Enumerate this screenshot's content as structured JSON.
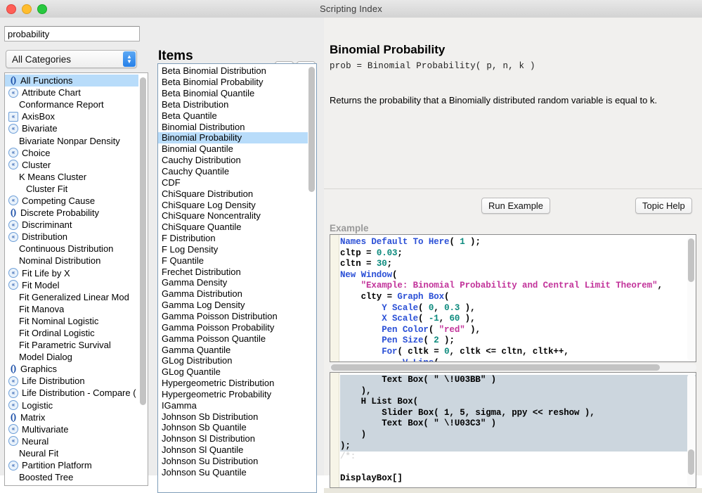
{
  "window": {
    "title": "Scripting Index"
  },
  "traffic_lights": {
    "close": "close-button",
    "minimize": "minimize-button",
    "maximize": "maximize-button"
  },
  "search": {
    "value": "probability",
    "placeholder": "",
    "search_icon": "magnifier-icon",
    "clear_icon": "x-icon",
    "settings_icon": "gear-icon"
  },
  "category": {
    "selected": "All Categories",
    "options": [
      "All Categories"
    ]
  },
  "tree": {
    "items": [
      {
        "label": "All Functions",
        "icon": "paren",
        "indent": 0,
        "selected": true
      },
      {
        "label": "Attribute Chart",
        "icon": "circ",
        "indent": 0,
        "selected": false
      },
      {
        "label": "Conformance Report",
        "icon": "blank",
        "indent": 1,
        "selected": false
      },
      {
        "label": "AxisBox",
        "icon": "sq",
        "indent": 0,
        "selected": false
      },
      {
        "label": "Bivariate",
        "icon": "circ",
        "indent": 0,
        "selected": false
      },
      {
        "label": "Bivariate Nonpar Density",
        "icon": "blank",
        "indent": 1,
        "selected": false
      },
      {
        "label": "Choice",
        "icon": "circ",
        "indent": 0,
        "selected": false
      },
      {
        "label": "Cluster",
        "icon": "circ",
        "indent": 0,
        "selected": false
      },
      {
        "label": "K Means Cluster",
        "icon": "blank",
        "indent": 1,
        "selected": false
      },
      {
        "label": "Cluster Fit",
        "icon": "blank",
        "indent": 2,
        "selected": false
      },
      {
        "label": "Competing Cause",
        "icon": "circ",
        "indent": 0,
        "selected": false
      },
      {
        "label": "Discrete Probability",
        "icon": "paren",
        "indent": 0,
        "selected": false
      },
      {
        "label": "Discriminant",
        "icon": "circ",
        "indent": 0,
        "selected": false
      },
      {
        "label": "Distribution",
        "icon": "circ",
        "indent": 0,
        "selected": false
      },
      {
        "label": "Continuous Distribution",
        "icon": "blank",
        "indent": 1,
        "selected": false
      },
      {
        "label": "Nominal Distribution",
        "icon": "blank",
        "indent": 1,
        "selected": false
      },
      {
        "label": "Fit Life by X",
        "icon": "circ",
        "indent": 0,
        "selected": false
      },
      {
        "label": "Fit Model",
        "icon": "circ",
        "indent": 0,
        "selected": false
      },
      {
        "label": "Fit Generalized Linear Mod",
        "icon": "blank",
        "indent": 1,
        "selected": false
      },
      {
        "label": "Fit Manova",
        "icon": "blank",
        "indent": 1,
        "selected": false
      },
      {
        "label": "Fit Nominal Logistic",
        "icon": "blank",
        "indent": 1,
        "selected": false
      },
      {
        "label": "Fit Ordinal Logistic",
        "icon": "blank",
        "indent": 1,
        "selected": false
      },
      {
        "label": "Fit Parametric Survival",
        "icon": "blank",
        "indent": 1,
        "selected": false
      },
      {
        "label": "Model Dialog",
        "icon": "blank",
        "indent": 1,
        "selected": false
      },
      {
        "label": "Graphics",
        "icon": "paren",
        "indent": 0,
        "selected": false
      },
      {
        "label": "Life Distribution",
        "icon": "circ",
        "indent": 0,
        "selected": false
      },
      {
        "label": "Life Distribution - Compare (",
        "icon": "circ",
        "indent": 0,
        "selected": false
      },
      {
        "label": "Logistic",
        "icon": "circ",
        "indent": 0,
        "selected": false
      },
      {
        "label": "Matrix",
        "icon": "paren",
        "indent": 0,
        "selected": false
      },
      {
        "label": "Multivariate",
        "icon": "circ",
        "indent": 0,
        "selected": false
      },
      {
        "label": "Neural",
        "icon": "circ",
        "indent": 0,
        "selected": false
      },
      {
        "label": "Neural Fit",
        "icon": "blank",
        "indent": 1,
        "selected": false
      },
      {
        "label": "Partition Platform",
        "icon": "circ",
        "indent": 0,
        "selected": false
      },
      {
        "label": "Boosted Tree",
        "icon": "blank",
        "indent": 1,
        "selected": false
      }
    ]
  },
  "items_panel": {
    "title": "Items",
    "up_icon": "arrow-up-icon",
    "down_icon": "arrow-down-icon",
    "items": [
      {
        "label": "Beta Binomial Distribution",
        "selected": false
      },
      {
        "label": "Beta Binomial Probability",
        "selected": false
      },
      {
        "label": "Beta Binomial Quantile",
        "selected": false
      },
      {
        "label": "Beta Distribution",
        "selected": false
      },
      {
        "label": "Beta Quantile",
        "selected": false
      },
      {
        "label": "Binomial Distribution",
        "selected": false
      },
      {
        "label": "Binomial Probability",
        "selected": true
      },
      {
        "label": "Binomial Quantile",
        "selected": false
      },
      {
        "label": "Cauchy Distribution",
        "selected": false
      },
      {
        "label": "Cauchy Quantile",
        "selected": false
      },
      {
        "label": "CDF",
        "selected": false
      },
      {
        "label": "ChiSquare Distribution",
        "selected": false
      },
      {
        "label": "ChiSquare Log Density",
        "selected": false
      },
      {
        "label": "ChiSquare Noncentrality",
        "selected": false
      },
      {
        "label": "ChiSquare Quantile",
        "selected": false
      },
      {
        "label": "F Distribution",
        "selected": false
      },
      {
        "label": "F Log Density",
        "selected": false
      },
      {
        "label": "F Quantile",
        "selected": false
      },
      {
        "label": "Frechet Distribution",
        "selected": false
      },
      {
        "label": "Gamma Density",
        "selected": false
      },
      {
        "label": "Gamma Distribution",
        "selected": false
      },
      {
        "label": "Gamma Log Density",
        "selected": false
      },
      {
        "label": "Gamma Poisson Distribution",
        "selected": false
      },
      {
        "label": "Gamma Poisson Probability",
        "selected": false
      },
      {
        "label": "Gamma Poisson Quantile",
        "selected": false
      },
      {
        "label": "Gamma Quantile",
        "selected": false
      },
      {
        "label": "GLog Distribution",
        "selected": false
      },
      {
        "label": "GLog Quantile",
        "selected": false
      },
      {
        "label": "Hypergeometric Distribution",
        "selected": false
      },
      {
        "label": "Hypergeometric Probability",
        "selected": false
      },
      {
        "label": "IGamma",
        "selected": false
      },
      {
        "label": "Johnson Sb Distribution",
        "selected": false
      },
      {
        "label": "Johnson Sb Quantile",
        "selected": false
      },
      {
        "label": "Johnson Sl Distribution",
        "selected": false
      },
      {
        "label": "Johnson Sl Quantile",
        "selected": false
      },
      {
        "label": "Johnson Su Distribution",
        "selected": false
      },
      {
        "label": "Johnson Su Quantile",
        "selected": false
      }
    ]
  },
  "doc": {
    "title": "Binomial Probability",
    "signature": "prob = Binomial Probability( p, n, k )",
    "description": "Returns the probability that a Binomially distributed random variable is equal to k.",
    "example_label": "Example",
    "run_example_label": "Run Example",
    "topic_help_label": "Topic Help"
  },
  "code_top": {
    "lines": [
      [
        [
          "kw",
          "Names Default To Here"
        ],
        [
          "pl",
          "( "
        ],
        [
          "num",
          "1"
        ],
        [
          "pl",
          " );"
        ]
      ],
      [
        [
          "pl",
          "cltp = "
        ],
        [
          "num",
          "0.03"
        ],
        [
          "pl",
          ";"
        ]
      ],
      [
        [
          "pl",
          "cltn = "
        ],
        [
          "num",
          "30"
        ],
        [
          "pl",
          ";"
        ]
      ],
      [
        [
          "kw",
          "New Window"
        ],
        [
          "pl",
          "("
        ]
      ],
      [
        [
          "pl",
          "    "
        ],
        [
          "str",
          "\"Example: Binomial Probability and Central Limit Theorem\""
        ],
        [
          "pl",
          ","
        ]
      ],
      [
        [
          "pl",
          "    clty = "
        ],
        [
          "kw",
          "Graph Box"
        ],
        [
          "pl",
          "("
        ]
      ],
      [
        [
          "pl",
          "        "
        ],
        [
          "kw",
          "Y Scale"
        ],
        [
          "pl",
          "( "
        ],
        [
          "num",
          "0"
        ],
        [
          "pl",
          ", "
        ],
        [
          "num",
          "0.3"
        ],
        [
          "pl",
          " ),"
        ]
      ],
      [
        [
          "pl",
          "        "
        ],
        [
          "kw",
          "X Scale"
        ],
        [
          "pl",
          "( "
        ],
        [
          "num",
          "-1"
        ],
        [
          "pl",
          ", "
        ],
        [
          "num",
          "60"
        ],
        [
          "pl",
          " ),"
        ]
      ],
      [
        [
          "pl",
          "        "
        ],
        [
          "kw",
          "Pen Color"
        ],
        [
          "pl",
          "( "
        ],
        [
          "str",
          "\"red\""
        ],
        [
          "pl",
          " ),"
        ]
      ],
      [
        [
          "pl",
          "        "
        ],
        [
          "kw",
          "Pen Size"
        ],
        [
          "pl",
          "( "
        ],
        [
          "num",
          "2"
        ],
        [
          "pl",
          " );"
        ]
      ],
      [
        [
          "pl",
          "        "
        ],
        [
          "kw",
          "For"
        ],
        [
          "pl",
          "( cltk = "
        ],
        [
          "num",
          "0"
        ],
        [
          "pl",
          ", cltk <= cltn, cltk++,"
        ]
      ],
      [
        [
          "pl",
          "            "
        ],
        [
          "kw",
          "V Line"
        ],
        [
          "pl",
          "("
        ]
      ]
    ]
  },
  "code_bottom": {
    "lines": [
      [
        [
          "pl",
          "        Text Box( \" \\!U03BB\" )"
        ]
      ],
      [
        [
          "pl",
          "    ),"
        ]
      ],
      [
        [
          "pl",
          "    H List Box("
        ]
      ],
      [
        [
          "pl",
          "        Slider Box( 1, 5, sigma, ppy << reshow ),"
        ]
      ],
      [
        [
          "pl",
          "        Text Box( \" \\!U03C3\" )"
        ]
      ],
      [
        [
          "pl",
          "    )"
        ]
      ],
      [
        [
          "pl",
          ");"
        ]
      ],
      [
        [
          "cmt",
          "/*:"
        ]
      ],
      [
        [
          "pl",
          ""
        ]
      ],
      [
        [
          "pl",
          "DisplayBox[]"
        ]
      ]
    ],
    "selected_line_count": 7
  },
  "colors": {
    "selection_blue": "#b8dcfa",
    "keyword_blue": "#2a4fd6",
    "number_teal": "#0b8a7d",
    "string_magenta": "#c2339a",
    "code_selection": "#ccd6de",
    "accent_blue": "#267fe8"
  }
}
